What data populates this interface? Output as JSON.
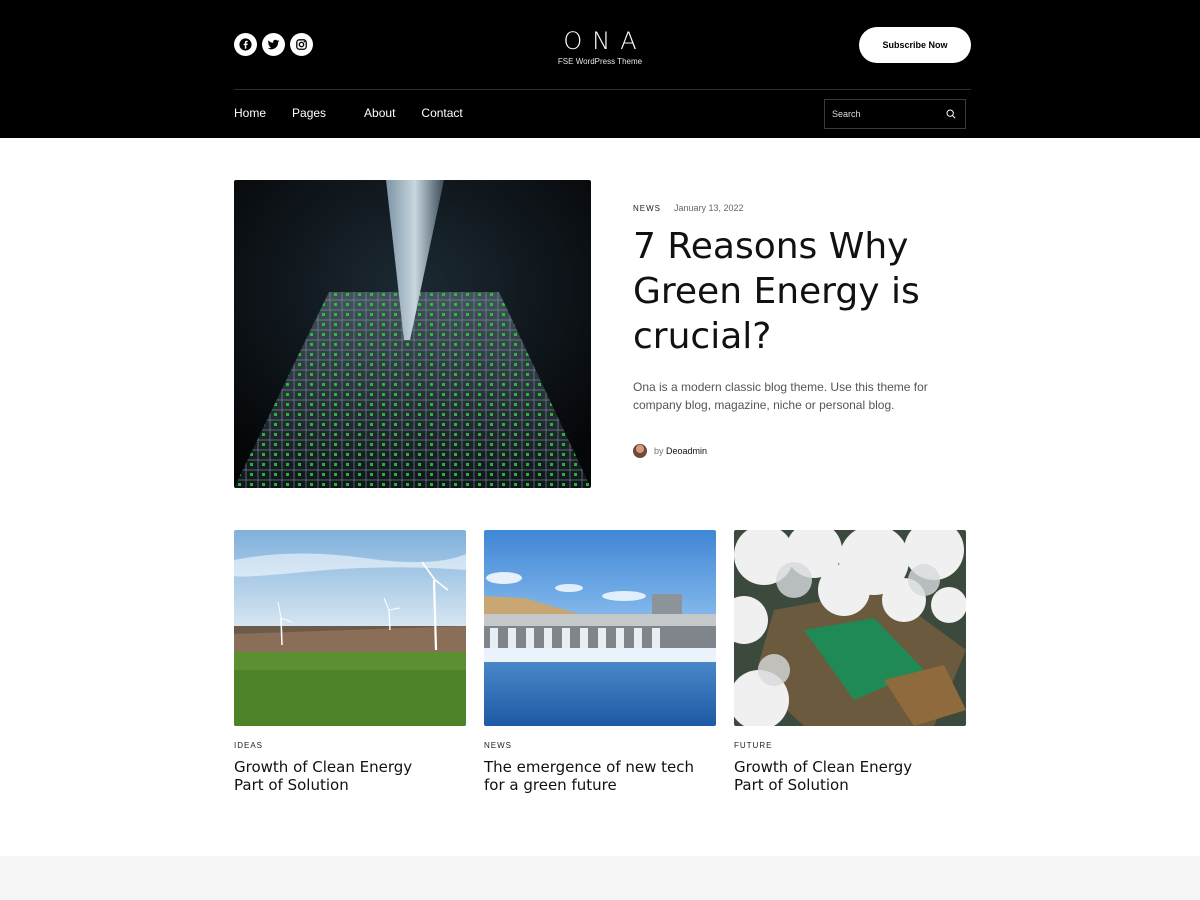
{
  "site": {
    "logo": "ONA",
    "tagline": "FSE WordPress Theme",
    "subscribe_label": "Subscribe Now"
  },
  "social": [
    {
      "icon": "facebook-icon"
    },
    {
      "icon": "twitter-icon"
    },
    {
      "icon": "instagram-icon"
    }
  ],
  "nav": {
    "items": [
      "Home",
      "Pages",
      "About",
      "Contact"
    ]
  },
  "search": {
    "placeholder": "Search",
    "icon": "search-icon"
  },
  "featured": {
    "category": "NEWS",
    "date": "January 13, 2022",
    "title": "7 Reasons Why Green Energy is crucial?",
    "excerpt": "Ona is a modern classic blog theme. Use this theme for company blog, magazine, niche or personal blog.",
    "author_prefix": "by",
    "author": "Deoadmin"
  },
  "posts": [
    {
      "category": "IDEAS",
      "title": "Growth of Clean Energy Part of Solution"
    },
    {
      "category": "NEWS",
      "title": "The emergence of new tech for a green future"
    },
    {
      "category": "FUTURE",
      "title": "Growth of Clean Energy Part of Solution"
    }
  ],
  "colors": {
    "header_bg": "#000000",
    "page_bg": "#ffffff",
    "footer_bg": "#f6f6f6",
    "text": "#111111"
  }
}
